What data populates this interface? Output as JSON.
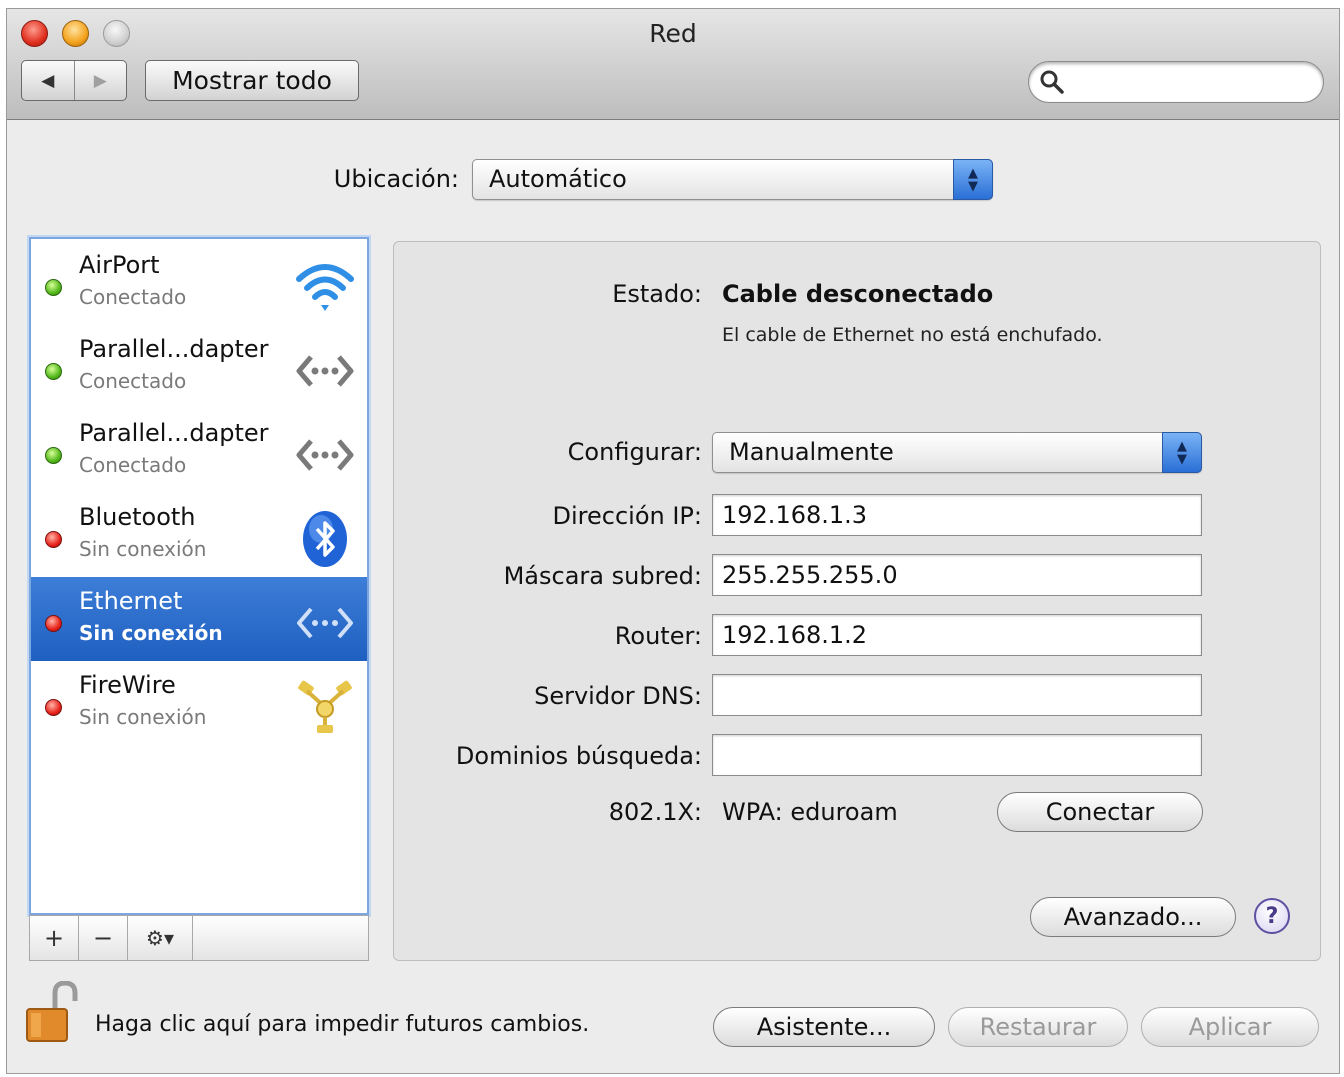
{
  "window": {
    "title": "Red"
  },
  "toolbar": {
    "back_icon": "◀",
    "forward_icon": "▶",
    "show_all_label": "Mostrar todo",
    "search_placeholder": ""
  },
  "location": {
    "label": "Ubicación:",
    "value": "Automático"
  },
  "services": [
    {
      "name": "AirPort",
      "status": "Conectado",
      "status_color": "green",
      "icon": "wifi-icon"
    },
    {
      "name": "Parallel...dapter",
      "status": "Conectado",
      "status_color": "green",
      "icon": "ethernet-arrows-icon"
    },
    {
      "name": "Parallel...dapter",
      "status": "Conectado",
      "status_color": "green",
      "icon": "ethernet-arrows-icon"
    },
    {
      "name": "Bluetooth",
      "status": "Sin conexión",
      "status_color": "red",
      "icon": "bluetooth-icon"
    },
    {
      "name": "Ethernet",
      "status": "Sin conexión",
      "status_color": "red",
      "icon": "ethernet-arrows-icon",
      "selected": true
    },
    {
      "name": "FireWire",
      "status": "Sin conexión",
      "status_color": "red",
      "icon": "firewire-icon"
    }
  ],
  "list_controls": {
    "add": "+",
    "remove": "−",
    "gear": "⚙▾"
  },
  "detail": {
    "status_label": "Estado:",
    "status_value": "Cable desconectado",
    "status_description": "El cable de Ethernet no está enchufado.",
    "configure_label": "Configurar:",
    "configure_value": "Manualmente",
    "ip_label": "Dirección IP:",
    "ip_value": "192.168.1.3",
    "mask_label": "Máscara subred:",
    "mask_value": "255.255.255.0",
    "router_label": "Router:",
    "router_value": "192.168.1.2",
    "dns_label": "Servidor DNS:",
    "dns_value": "",
    "search_domains_label": "Dominios búsqueda:",
    "search_domains_value": "",
    "dot1x_label": "802.1X:",
    "dot1x_value": "WPA: eduroam",
    "connect_button": "Conectar",
    "advanced_button": "Avanzado...",
    "help_button": "?"
  },
  "footer": {
    "lock_text": "Haga clic aquí para impedir futuros cambios.",
    "assistant_button": "Asistente...",
    "revert_button": "Restaurar",
    "apply_button": "Aplicar"
  },
  "colors": {
    "selection": "#2a6acb",
    "status_green": "#53b81a",
    "status_red": "#e8231b",
    "popup_arrow": "#3b82e0"
  }
}
